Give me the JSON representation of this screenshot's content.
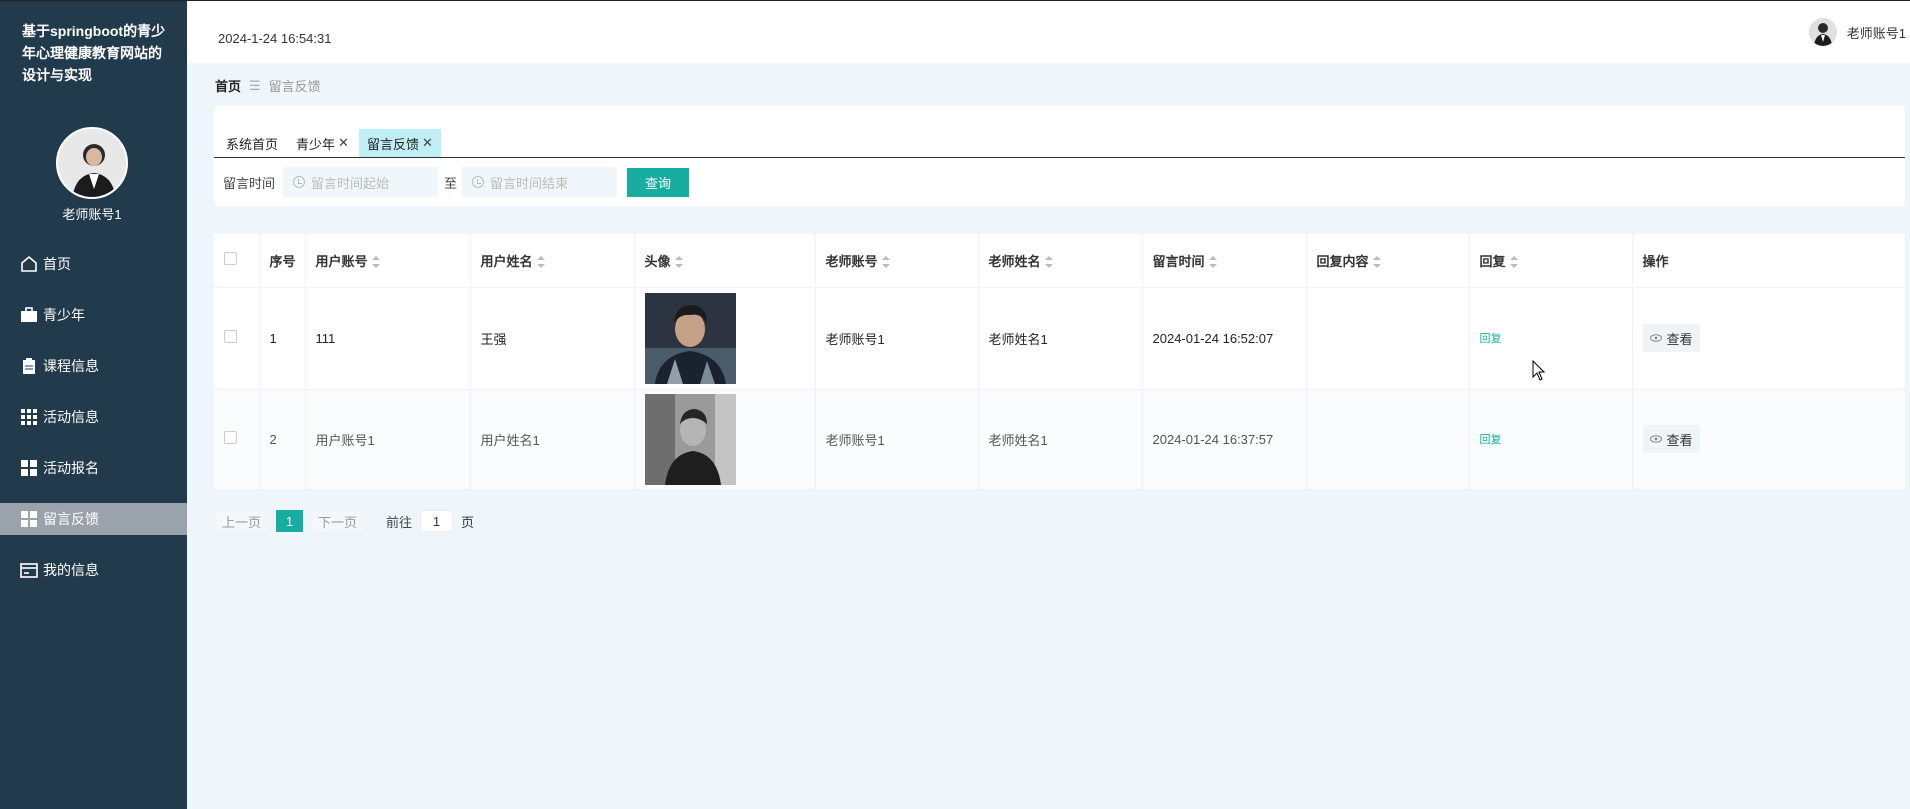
{
  "app": {
    "title": "基于springboot的青少年心理健康教育网站的设计与实现",
    "username": "老师账号1",
    "datetime": "2024-1-24 16:54:31"
  },
  "sidebar": {
    "items": [
      {
        "label": "首页",
        "icon": "home-icon"
      },
      {
        "label": "青少年",
        "icon": "briefcase-icon"
      },
      {
        "label": "课程信息",
        "icon": "clipboard-icon"
      },
      {
        "label": "活动信息",
        "icon": "grid-icon"
      },
      {
        "label": "活动报名",
        "icon": "apps-icon"
      },
      {
        "label": "留言反馈",
        "icon": "apps-icon",
        "active": true
      },
      {
        "label": "我的信息",
        "icon": "card-icon"
      }
    ]
  },
  "breadcrumb": {
    "home": "首页",
    "current": "留言反馈"
  },
  "tabs": [
    {
      "label": "系统首页",
      "closable": false
    },
    {
      "label": "青少年",
      "closable": true
    },
    {
      "label": "留言反馈",
      "closable": true,
      "active": true
    }
  ],
  "search": {
    "label": "留言时间",
    "start_placeholder": "留言时间起始",
    "to": "至",
    "end_placeholder": "留言时间结束",
    "button": "查询"
  },
  "table": {
    "columns": [
      "序号",
      "用户账号",
      "用户姓名",
      "头像",
      "老师账号",
      "老师姓名",
      "留言时间",
      "回复内容",
      "回复",
      "操作"
    ],
    "rows": [
      {
        "index": "1",
        "user_account": "111",
        "user_name": "王强",
        "teacher_account": "老师账号1",
        "teacher_name": "老师姓名1",
        "time": "2024-01-24 16:52:07",
        "reply_content": "",
        "reply": "回复",
        "action": "查看"
      },
      {
        "index": "2",
        "user_account": "用户账号1",
        "user_name": "用户姓名1",
        "teacher_account": "老师账号1",
        "teacher_name": "老师姓名1",
        "time": "2024-01-24 16:37:57",
        "reply_content": "",
        "reply": "回复",
        "action": "查看"
      }
    ]
  },
  "pagination": {
    "prev": "上一页",
    "current": "1",
    "next": "下一页",
    "goto_prefix": "前往",
    "goto_value": "1",
    "goto_suffix": "页"
  },
  "colors": {
    "accent": "#17ada0",
    "sidebar": "#213b4d",
    "active_tab": "#bfeff5"
  }
}
